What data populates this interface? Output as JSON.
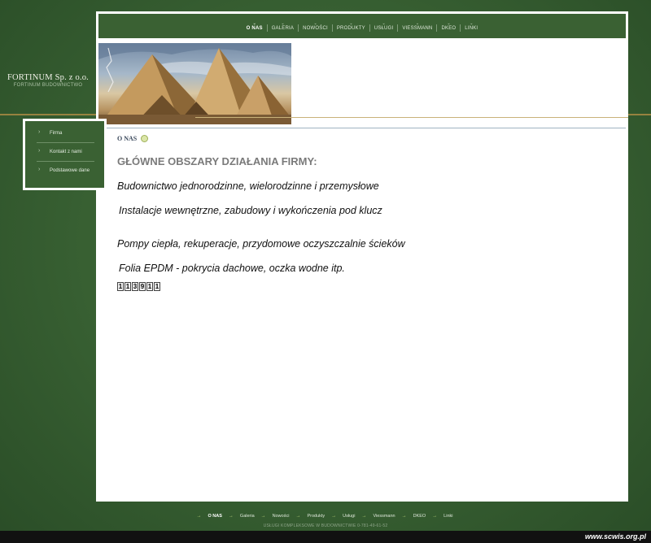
{
  "brand": {
    "name": "FORTINUM Sp. z o.o.",
    "subtitle": "FORTINUM BUDOWNICTWO"
  },
  "nav": {
    "items": [
      {
        "label": "O NAS",
        "active": true
      },
      {
        "label": "GALERIA"
      },
      {
        "label": "NOWOŚCI"
      },
      {
        "label": "PRODUKTY"
      },
      {
        "label": "USŁUGI"
      },
      {
        "label": "VIESSMANN"
      },
      {
        "label": "DKEO"
      },
      {
        "label": "LINKI"
      }
    ]
  },
  "sidebar": {
    "items": [
      {
        "label": "Firma"
      },
      {
        "label": "Kontakt z nami"
      },
      {
        "label": "Podstawowe dane"
      }
    ]
  },
  "main": {
    "breadcrumb": "O NAS",
    "heading": "GŁÓWNE OBSZARY DZIAŁANIA FIRMY:",
    "lines": [
      "Budownictwo jednorodzinne, wielorodzinne i przemysłowe",
      "Instalacje wewnętrzne, zabudowy i wykończenia pod klucz",
      "Pompy ciepła, rekuperacje, przydomowe oczyszczalnie ścieków",
      "Folia EPDM - pokrycia dachowe, oczka wodne itp."
    ],
    "counter": "113911"
  },
  "footer": {
    "items": [
      {
        "label": "O NAS",
        "active": true
      },
      {
        "label": "Galeria"
      },
      {
        "label": "Nowości"
      },
      {
        "label": "Produkty"
      },
      {
        "label": "Usługi"
      },
      {
        "label": "Viessmann"
      },
      {
        "label": "DKEO"
      },
      {
        "label": "Linki"
      }
    ],
    "tagline": "USŁUGI KOMPLEKSOWE W BUDOWNICTWIE 0-781-49-61-52"
  },
  "watermark": "www.scwis.org.pl",
  "colors": {
    "background": "#3a6334",
    "panel": "#ffffff",
    "accent_gold": "#a98a43",
    "nav_green": "#3a6133"
  }
}
